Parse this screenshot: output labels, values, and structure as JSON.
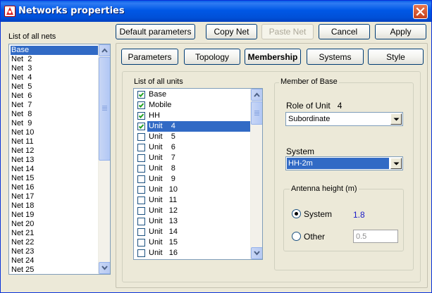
{
  "window": {
    "title": "Networks properties"
  },
  "toolbar": {
    "default_label": "Default parameters",
    "copy_label": "Copy Net",
    "paste_label": "Paste Net",
    "cancel_label": "Cancel",
    "apply_label": "Apply"
  },
  "nets": {
    "label": "List of all nets",
    "items": [
      "Base",
      "Net  2",
      "Net  3",
      "Net  4",
      "Net  5",
      "Net  6",
      "Net  7",
      "Net  8",
      "Net  9",
      "Net 10",
      "Net 11",
      "Net 12",
      "Net 13",
      "Net 14",
      "Net 15",
      "Net 16",
      "Net 17",
      "Net 18",
      "Net 19",
      "Net 20",
      "Net 21",
      "Net 22",
      "Net 23",
      "Net 24",
      "Net 25"
    ],
    "selected_index": 0
  },
  "tabs": [
    "Parameters",
    "Topology",
    "Membership",
    "Systems",
    "Style"
  ],
  "active_tab": "Membership",
  "units": {
    "label": "List of all units",
    "items": [
      {
        "label": "Base",
        "checked": true
      },
      {
        "label": "Mobile",
        "checked": true
      },
      {
        "label": "HH",
        "checked": true
      },
      {
        "label": "Unit    4",
        "checked": true
      },
      {
        "label": "Unit    5",
        "checked": false
      },
      {
        "label": "Unit    6",
        "checked": false
      },
      {
        "label": "Unit    7",
        "checked": false
      },
      {
        "label": "Unit    8",
        "checked": false
      },
      {
        "label": "Unit    9",
        "checked": false
      },
      {
        "label": "Unit   10",
        "checked": false
      },
      {
        "label": "Unit   11",
        "checked": false
      },
      {
        "label": "Unit   12",
        "checked": false
      },
      {
        "label": "Unit   13",
        "checked": false
      },
      {
        "label": "Unit   14",
        "checked": false
      },
      {
        "label": "Unit   15",
        "checked": false
      },
      {
        "label": "Unit   16",
        "checked": false
      }
    ],
    "selected_index": 3
  },
  "member": {
    "group_title": "Member of Base",
    "role_label": "Role of Unit",
    "role_unit_number": "4",
    "role_value": "Subordinate",
    "system_label": "System",
    "system_value": "HH-2m",
    "antenna": {
      "group_title": "Antenna height (m)",
      "system_option": "System",
      "system_value": "1.8",
      "other_option": "Other",
      "other_value": "0.5",
      "selected": "system"
    }
  }
}
